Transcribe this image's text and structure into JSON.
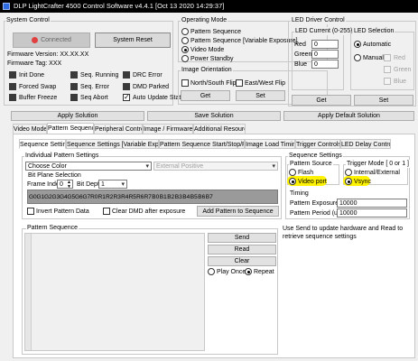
{
  "window": {
    "title": "DLP LightCrafter 4500 Control Software v4.4.1 [Oct 13 2020 14:29:37]"
  },
  "system_control": {
    "title": "System Control",
    "connected_label": "Connected",
    "connected_color": "#c0c0c0",
    "reset_label": "System Reset",
    "firmware_version": "Firmware Version:  XX.XX.XX",
    "firmware_tag": "Firmware Tag:  XXX",
    "status_left": [
      "Init Done",
      "Forced Swap",
      "Buffer Freeze"
    ],
    "status_mid": [
      "Seq. Running",
      "Seq. Error",
      "Seq Abort"
    ],
    "status_right": [
      "DRC Error",
      "DMD Parked"
    ],
    "auto_update_label": "Auto Update Status",
    "auto_update_checked": true
  },
  "operating_mode": {
    "title": "Operating Mode",
    "options": [
      "Pattern Sequence",
      "Pattern Sequence [Variable Exposure]",
      "Video Mode",
      "Power Standby"
    ],
    "selected_index": 2
  },
  "image_orientation": {
    "title": "Image Orientation",
    "ns_flip": "North/South Flip",
    "ew_flip": "East/West Flip",
    "get": "Get",
    "set": "Set"
  },
  "led_driver": {
    "title": "LED Driver Control",
    "current_title": "LED Current (0-255)",
    "red_label": "Red",
    "red_value": "0",
    "green_label": "Green",
    "green_value": "0",
    "blue_label": "Blue",
    "blue_value": "0",
    "get": "Get"
  },
  "led_selection": {
    "title": "LED Selection",
    "automatic": "Automatic",
    "manual": "Manual",
    "red": "Red",
    "green": "Green",
    "blue": "Blue",
    "set": "Set"
  },
  "actions": {
    "apply_solution": "Apply Solution",
    "save_solution": "Save Solution",
    "apply_default_solution": "Apply Default Solution"
  },
  "main_tabs": [
    "Video Mode",
    "Pattern Sequence",
    "Peripheral Control",
    "Image / Firmware",
    "Additional Resources"
  ],
  "sub_tabs": [
    "Sequence Settings",
    "Sequence Settings [Variable Exposure]",
    "Pattern Sequence Start/Stop/Pause",
    "Image Load Timing",
    "Trigger Controls",
    "LED Delay Control"
  ],
  "individual_pattern": {
    "title": "Individual Pattern Settings",
    "color_select": "Choose Color",
    "external_select": "External Positive",
    "bit_plane_title": "Bit Plane Selection",
    "frame_index_label": "Frame Index",
    "frame_index_value": "0",
    "bit_depth_label": "Bit Depth",
    "bit_depth_value": "1",
    "bits": [
      "G0",
      "G1",
      "G2",
      "G3",
      "G4",
      "G5",
      "G6",
      "G7",
      "R0",
      "R1",
      "R2",
      "R3",
      "R4",
      "R5",
      "R6",
      "R7",
      "B0",
      "B1",
      "B2",
      "B3",
      "B4",
      "B5",
      "B6",
      "B7"
    ],
    "invert_label": "Invert Pattern Data",
    "clear_dmd_label": "Clear DMD after exposure",
    "add_pattern_label": "Add Pattern to Sequence"
  },
  "sequence_settings": {
    "title": "Sequence Settings",
    "pattern_source_title": "Pattern Source",
    "flash": "Flash",
    "video_port": "Video port",
    "trigger_mode_title": "Trigger Mode [ 0 or 1 ]",
    "internal_external": "Internal/External",
    "vsync": "Vsync",
    "timing_title": "Timing",
    "exposure_label": "Pattern Exposure (us)",
    "exposure_value": "10000",
    "period_label": "Pattern Period (us)",
    "period_value": "10000"
  },
  "pattern_sequence": {
    "title": "Pattern Sequence",
    "send": "Send",
    "read": "Read",
    "clear": "Clear",
    "play_once": "Play Once",
    "repeat": "Repeat",
    "help_text": "Use Send to update hardware and Read to retrieve sequence settings"
  },
  "highlight_color": "#fff200"
}
